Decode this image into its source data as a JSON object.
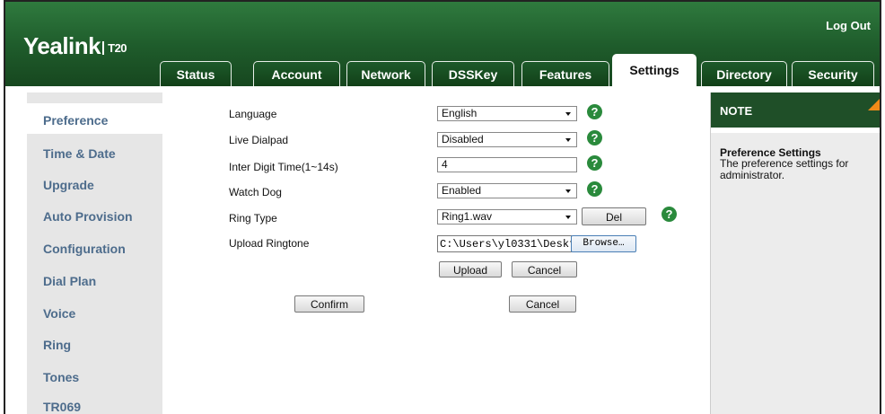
{
  "header": {
    "brand": "Yealink",
    "model": "T20",
    "logout": "Log Out"
  },
  "tabs": [
    {
      "label": "Status",
      "active": false
    },
    {
      "label": "Account",
      "active": false
    },
    {
      "label": "Network",
      "active": false
    },
    {
      "label": "DSSKey",
      "active": false
    },
    {
      "label": "Features",
      "active": false
    },
    {
      "label": "Settings",
      "active": true
    },
    {
      "label": "Directory",
      "active": false
    },
    {
      "label": "Security",
      "active": false
    }
  ],
  "sidebar": {
    "items": [
      {
        "label": "Preference",
        "active": true
      },
      {
        "label": "Time & Date"
      },
      {
        "label": "Upgrade"
      },
      {
        "label": "Auto Provision"
      },
      {
        "label": "Configuration"
      },
      {
        "label": "Dial Plan"
      },
      {
        "label": "Voice"
      },
      {
        "label": "Ring"
      },
      {
        "label": "Tones"
      },
      {
        "label": "TR069"
      }
    ]
  },
  "form": {
    "language": {
      "label": "Language",
      "value": "English"
    },
    "live_dialpad": {
      "label": "Live Dialpad",
      "value": "Disabled"
    },
    "inter_digit": {
      "label": "Inter Digit Time(1~14s)",
      "value": "4"
    },
    "watch_dog": {
      "label": "Watch Dog",
      "value": "Enabled"
    },
    "ring_type": {
      "label": "Ring Type",
      "value": "Ring1.wav",
      "del_label": "Del"
    },
    "upload_ringtone": {
      "label": "Upload Ringtone",
      "file_value": "C:\\Users\\yl0331\\Deskt",
      "browse_label": "Browse…",
      "upload_label": "Upload",
      "cancel_label": "Cancel"
    },
    "help_glyph": "?",
    "confirm_label": "Confirm",
    "cancel_label": "Cancel"
  },
  "note": {
    "header": "NOTE",
    "title": "Preference Settings",
    "text": "The preference settings for administrator."
  },
  "colors": {
    "header_green": "#1f5d2c",
    "help_green": "#2a8a3c",
    "sidebar_text": "#4d6c8c",
    "note_corner": "#f08a18"
  }
}
